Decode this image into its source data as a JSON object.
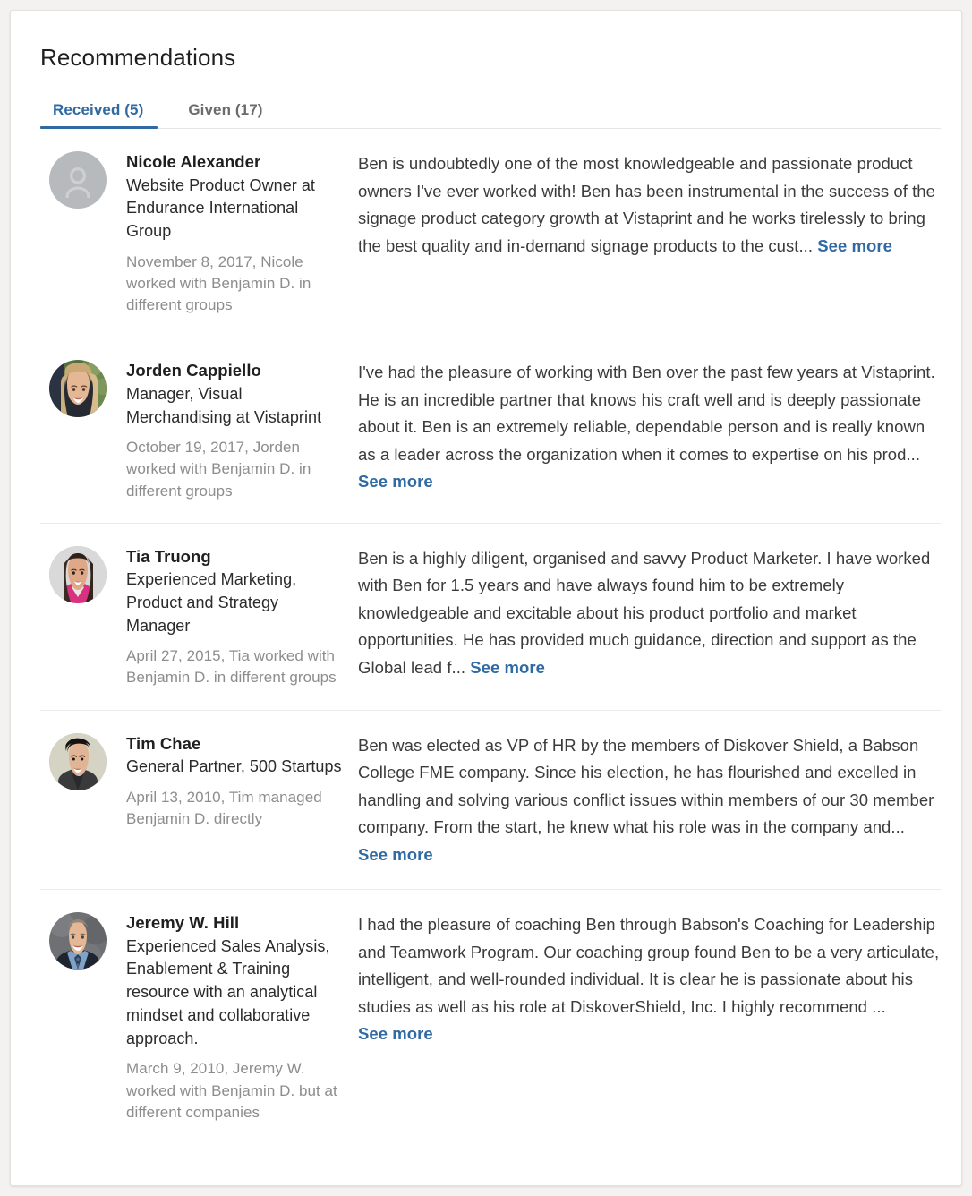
{
  "card": {
    "title": "Recommendations"
  },
  "tabs": [
    {
      "label": "Received (5)",
      "active": true
    },
    {
      "label": "Given (17)",
      "active": false
    }
  ],
  "colors": {
    "accent": "#2f6aa3",
    "page_background": "#f3f2f0",
    "card_background": "#ffffff",
    "divider": "#eceae8",
    "name_text": "#1f1f1f",
    "meta_text": "#8d8d8d",
    "body_text": "#3b3b3b"
  },
  "see_more_label": "See more",
  "recommendations": [
    {
      "name": "Nicole Alexander",
      "headline": "Website Product Owner at Endurance International Group",
      "meta": "November 8, 2017, Nicole worked with Benjamin D. in different groups",
      "body": "Ben is undoubtedly one of the most knowledgeable and passionate product owners I've ever worked with! Ben has been instrumental in the success of the signage product category growth at Vistaprint and he works tirelessly to bring the best quality and in-demand signage products to the cust...",
      "avatar": {
        "type": "placeholder",
        "icon": "person-icon",
        "background": "#b7babd",
        "glyph_color": "#cbcdcf"
      }
    },
    {
      "name": "Jorden Cappiello",
      "headline": "Manager, Visual Merchandising at Vistaprint",
      "meta": "October 19, 2017, Jorden worked with Benjamin D. in different groups",
      "body": "I've had the pleasure of working with Ben over the past few years at Vistaprint. He is an incredible partner that knows his craft well and is deeply passionate about it. Ben is an extremely reliable, dependable person and is really known as a leader across the organization when it comes to expertise on his prod...",
      "avatar": {
        "type": "photo",
        "id": "avatar-jorden",
        "background": "#4e6a43",
        "hair": "#c9a875",
        "clothing": "#262b33",
        "skin": "#e3b596"
      }
    },
    {
      "name": "Tia Truong",
      "headline": "Experienced Marketing, Product and Strategy Manager",
      "meta": "April 27, 2015, Tia worked with Benjamin D. in different groups",
      "body": "Ben is a highly diligent, organised and savvy Product Marketer. I have worked with Ben for 1.5 years and have always found him to be extremely knowledgeable and excitable about his product portfolio and market opportunities. He has provided much guidance, direction and support as the Global lead f...",
      "avatar": {
        "type": "photo",
        "id": "avatar-tia",
        "background": "#d8d8d8",
        "hair": "#3a2a22",
        "clothing": "#d9317f",
        "skin": "#dfa987"
      }
    },
    {
      "name": "Tim Chae",
      "headline": "General Partner, 500 Startups",
      "meta": "April 13, 2010, Tim managed Benjamin D. directly",
      "body": "Ben was elected as VP of HR by the members of Diskover Shield, a Babson College FME company. Since his election, he has flourished and excelled in handling and solving various conflict issues within members of our 30 member company. From the start, he knew what his role was in the company and...",
      "avatar": {
        "type": "photo",
        "id": "avatar-tim",
        "background": "#d5d3c3",
        "hair": "#15120f",
        "clothing": "#3a3a3c",
        "skin": "#e0b494"
      }
    },
    {
      "name": "Jeremy W. Hill",
      "headline": "Experienced Sales Analysis, Enablement & Training resource with an analytical mindset and collaborative approach.",
      "meta": "March 9, 2010, Jeremy W. worked with Benjamin D. but at different companies",
      "body": "I had the pleasure of coaching Ben through Babson's Coaching for Leadership and Teamwork Program. Our coaching group found Ben to be a very articulate, intelligent, and well-rounded individual. It is clear he is passionate about his studies as well as his role at DiskoverShield, Inc. I highly recommend ...",
      "avatar": {
        "type": "photo",
        "id": "avatar-jeremy",
        "background": "#6d6e70",
        "hair": "#8d7f70",
        "clothing": "#1e2430",
        "skin": "#e6b795",
        "shirt": "#7da3c8"
      }
    }
  ]
}
